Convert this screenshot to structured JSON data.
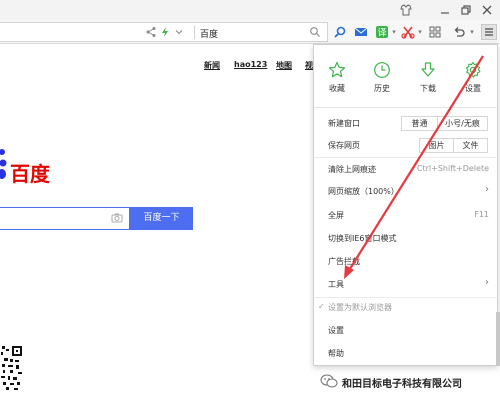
{
  "window": {
    "controls": [
      "shirt-icon",
      "minimize-icon",
      "restore-icon",
      "close-icon"
    ]
  },
  "toolbar": {
    "address_text": "百度",
    "icons": [
      "share-icon",
      "lightning-icon",
      "chevron-down-icon",
      "search-icon",
      "find-icon",
      "mail-icon",
      "translate-icon",
      "screenshot-icon",
      "apps-icon",
      "undo-icon",
      "menu-icon"
    ]
  },
  "page": {
    "nav_links": [
      "新闻",
      "hao123",
      "地图",
      "视"
    ],
    "logo_text": "百度",
    "search_button": "百度一下"
  },
  "menu": {
    "quick_actions": [
      {
        "label": "收藏",
        "icon": "star-icon"
      },
      {
        "label": "历史",
        "icon": "clock-icon"
      },
      {
        "label": "下载",
        "icon": "download-icon"
      },
      {
        "label": "设置",
        "icon": "gear-icon"
      }
    ],
    "items": [
      {
        "label": "新建窗口",
        "btn1": "普通",
        "btn2": "小号/无痕"
      },
      {
        "label": "保存网页",
        "btn1": "图片",
        "btn2": "文件"
      },
      {
        "label": "清除上网痕迹",
        "shortcut": "Ctrl+Shift+Delete"
      },
      {
        "label": "网页缩放（100%）",
        "arrow": "›"
      },
      {
        "label": "全屏",
        "shortcut": "F11"
      },
      {
        "label": "切换到IE6窗口模式"
      },
      {
        "label": "广告拦截"
      },
      {
        "label": "工具",
        "arrow": "›"
      },
      {
        "label": "设置为默认浏览器",
        "check": "✓"
      },
      {
        "label": "设置"
      },
      {
        "label": "帮助"
      }
    ]
  },
  "watermark": {
    "text": "和田目标电子科技有限公司"
  },
  "colors": {
    "baidu_red": "#e10602",
    "baidu_blue": "#2932e1",
    "search_blue": "#4e6ef2",
    "icon_green": "#3bb54a",
    "arrow_red": "#e8383d"
  }
}
